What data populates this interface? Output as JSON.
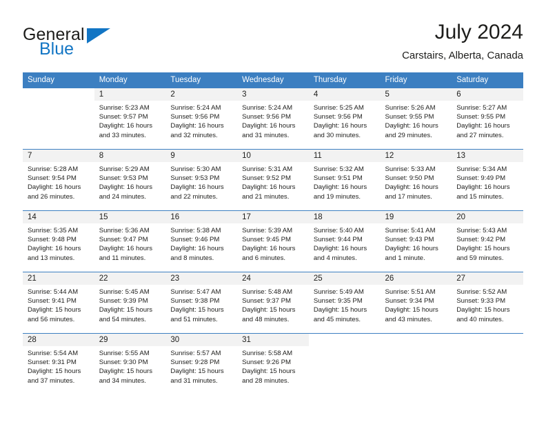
{
  "brand": {
    "name_part1": "General",
    "name_part2": "Blue",
    "accent_color": "#1275c4"
  },
  "header": {
    "title": "July 2024",
    "subtitle": "Carstairs, Alberta, Canada"
  },
  "theme": {
    "header_bar_color": "#3c7fc1",
    "daynum_band_color": "#f2f2f2",
    "text_color": "#1d1d1b"
  },
  "weekday_headers": [
    "Sunday",
    "Monday",
    "Tuesday",
    "Wednesday",
    "Thursday",
    "Friday",
    "Saturday"
  ],
  "weeks": [
    [
      {
        "day": "",
        "lines": [
          "",
          "",
          "",
          ""
        ]
      },
      {
        "day": "1",
        "lines": [
          "Sunrise: 5:23 AM",
          "Sunset: 9:57 PM",
          "Daylight: 16 hours",
          "and 33 minutes."
        ]
      },
      {
        "day": "2",
        "lines": [
          "Sunrise: 5:24 AM",
          "Sunset: 9:56 PM",
          "Daylight: 16 hours",
          "and 32 minutes."
        ]
      },
      {
        "day": "3",
        "lines": [
          "Sunrise: 5:24 AM",
          "Sunset: 9:56 PM",
          "Daylight: 16 hours",
          "and 31 minutes."
        ]
      },
      {
        "day": "4",
        "lines": [
          "Sunrise: 5:25 AM",
          "Sunset: 9:56 PM",
          "Daylight: 16 hours",
          "and 30 minutes."
        ]
      },
      {
        "day": "5",
        "lines": [
          "Sunrise: 5:26 AM",
          "Sunset: 9:55 PM",
          "Daylight: 16 hours",
          "and 29 minutes."
        ]
      },
      {
        "day": "6",
        "lines": [
          "Sunrise: 5:27 AM",
          "Sunset: 9:55 PM",
          "Daylight: 16 hours",
          "and 27 minutes."
        ]
      }
    ],
    [
      {
        "day": "7",
        "lines": [
          "Sunrise: 5:28 AM",
          "Sunset: 9:54 PM",
          "Daylight: 16 hours",
          "and 26 minutes."
        ]
      },
      {
        "day": "8",
        "lines": [
          "Sunrise: 5:29 AM",
          "Sunset: 9:53 PM",
          "Daylight: 16 hours",
          "and 24 minutes."
        ]
      },
      {
        "day": "9",
        "lines": [
          "Sunrise: 5:30 AM",
          "Sunset: 9:53 PM",
          "Daylight: 16 hours",
          "and 22 minutes."
        ]
      },
      {
        "day": "10",
        "lines": [
          "Sunrise: 5:31 AM",
          "Sunset: 9:52 PM",
          "Daylight: 16 hours",
          "and 21 minutes."
        ]
      },
      {
        "day": "11",
        "lines": [
          "Sunrise: 5:32 AM",
          "Sunset: 9:51 PM",
          "Daylight: 16 hours",
          "and 19 minutes."
        ]
      },
      {
        "day": "12",
        "lines": [
          "Sunrise: 5:33 AM",
          "Sunset: 9:50 PM",
          "Daylight: 16 hours",
          "and 17 minutes."
        ]
      },
      {
        "day": "13",
        "lines": [
          "Sunrise: 5:34 AM",
          "Sunset: 9:49 PM",
          "Daylight: 16 hours",
          "and 15 minutes."
        ]
      }
    ],
    [
      {
        "day": "14",
        "lines": [
          "Sunrise: 5:35 AM",
          "Sunset: 9:48 PM",
          "Daylight: 16 hours",
          "and 13 minutes."
        ]
      },
      {
        "day": "15",
        "lines": [
          "Sunrise: 5:36 AM",
          "Sunset: 9:47 PM",
          "Daylight: 16 hours",
          "and 11 minutes."
        ]
      },
      {
        "day": "16",
        "lines": [
          "Sunrise: 5:38 AM",
          "Sunset: 9:46 PM",
          "Daylight: 16 hours",
          "and 8 minutes."
        ]
      },
      {
        "day": "17",
        "lines": [
          "Sunrise: 5:39 AM",
          "Sunset: 9:45 PM",
          "Daylight: 16 hours",
          "and 6 minutes."
        ]
      },
      {
        "day": "18",
        "lines": [
          "Sunrise: 5:40 AM",
          "Sunset: 9:44 PM",
          "Daylight: 16 hours",
          "and 4 minutes."
        ]
      },
      {
        "day": "19",
        "lines": [
          "Sunrise: 5:41 AM",
          "Sunset: 9:43 PM",
          "Daylight: 16 hours",
          "and 1 minute."
        ]
      },
      {
        "day": "20",
        "lines": [
          "Sunrise: 5:43 AM",
          "Sunset: 9:42 PM",
          "Daylight: 15 hours",
          "and 59 minutes."
        ]
      }
    ],
    [
      {
        "day": "21",
        "lines": [
          "Sunrise: 5:44 AM",
          "Sunset: 9:41 PM",
          "Daylight: 15 hours",
          "and 56 minutes."
        ]
      },
      {
        "day": "22",
        "lines": [
          "Sunrise: 5:45 AM",
          "Sunset: 9:39 PM",
          "Daylight: 15 hours",
          "and 54 minutes."
        ]
      },
      {
        "day": "23",
        "lines": [
          "Sunrise: 5:47 AM",
          "Sunset: 9:38 PM",
          "Daylight: 15 hours",
          "and 51 minutes."
        ]
      },
      {
        "day": "24",
        "lines": [
          "Sunrise: 5:48 AM",
          "Sunset: 9:37 PM",
          "Daylight: 15 hours",
          "and 48 minutes."
        ]
      },
      {
        "day": "25",
        "lines": [
          "Sunrise: 5:49 AM",
          "Sunset: 9:35 PM",
          "Daylight: 15 hours",
          "and 45 minutes."
        ]
      },
      {
        "day": "26",
        "lines": [
          "Sunrise: 5:51 AM",
          "Sunset: 9:34 PM",
          "Daylight: 15 hours",
          "and 43 minutes."
        ]
      },
      {
        "day": "27",
        "lines": [
          "Sunrise: 5:52 AM",
          "Sunset: 9:33 PM",
          "Daylight: 15 hours",
          "and 40 minutes."
        ]
      }
    ],
    [
      {
        "day": "28",
        "lines": [
          "Sunrise: 5:54 AM",
          "Sunset: 9:31 PM",
          "Daylight: 15 hours",
          "and 37 minutes."
        ]
      },
      {
        "day": "29",
        "lines": [
          "Sunrise: 5:55 AM",
          "Sunset: 9:30 PM",
          "Daylight: 15 hours",
          "and 34 minutes."
        ]
      },
      {
        "day": "30",
        "lines": [
          "Sunrise: 5:57 AM",
          "Sunset: 9:28 PM",
          "Daylight: 15 hours",
          "and 31 minutes."
        ]
      },
      {
        "day": "31",
        "lines": [
          "Sunrise: 5:58 AM",
          "Sunset: 9:26 PM",
          "Daylight: 15 hours",
          "and 28 minutes."
        ]
      },
      {
        "day": "",
        "lines": [
          "",
          "",
          "",
          ""
        ]
      },
      {
        "day": "",
        "lines": [
          "",
          "",
          "",
          ""
        ]
      },
      {
        "day": "",
        "lines": [
          "",
          "",
          "",
          ""
        ]
      }
    ]
  ]
}
